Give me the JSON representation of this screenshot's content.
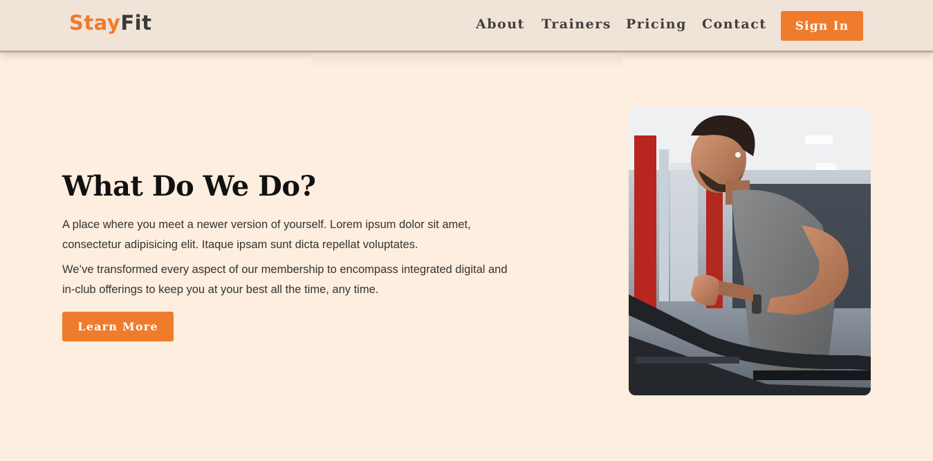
{
  "brand": {
    "part1": "Stay",
    "part2": "Fit",
    "accent_color": "#ef7b2d"
  },
  "nav": {
    "items": [
      {
        "label": "About"
      },
      {
        "label": "Trainers"
      },
      {
        "label": "Pricing"
      },
      {
        "label": "Contact"
      }
    ],
    "signin_label": "Sign In"
  },
  "hero": {
    "title": "What Do We Do?",
    "paragraph1": "A place where you meet a newer version of yourself. Lorem ipsum dolor sit amet, consectetur adipisicing elit. Itaque ipsam sunt dicta repellat voluptates.",
    "paragraph2": "We’ve transformed every aspect of our membership to encompass integrated digital and in-club offerings to keep you at your best all the time, any time.",
    "cta_label": "Learn More",
    "image_icon": "gym-treadmill-photo"
  },
  "colors": {
    "background": "#fdeedf",
    "header": "#f0e3d8",
    "button": "#ef7b2d"
  }
}
